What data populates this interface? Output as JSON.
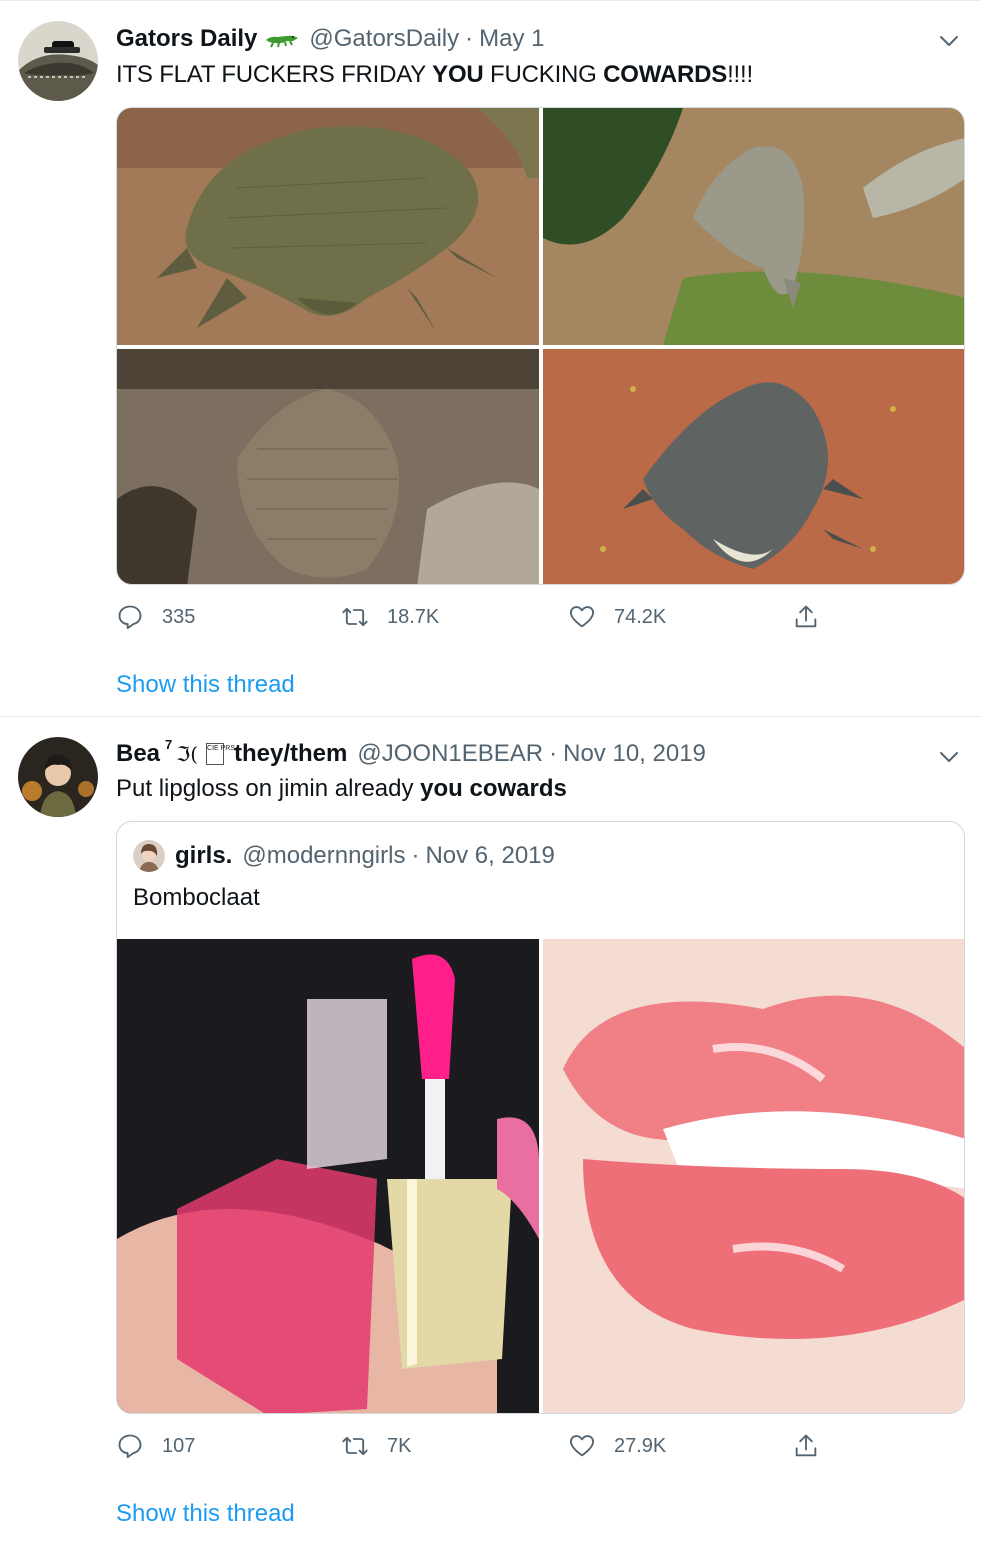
{
  "tweets": [
    {
      "display_name": "Gators Daily",
      "name_icon": "alligator-emoji-icon",
      "handle": "@GatorsDaily",
      "separator": "·",
      "date": "May 1",
      "text_parts": [
        "ITS FLAT FUCKERS FRIDAY ",
        "YOU",
        " FUCKING ",
        "COWARDS",
        "!!!!"
      ],
      "media": [
        {
          "icon": "crocodile-flat-sand-photo"
        },
        {
          "icon": "crocodiles-grass-photo"
        },
        {
          "icon": "crocodile-rock-photo"
        },
        {
          "icon": "crocodile-red-dirt-photo"
        }
      ],
      "actions": {
        "replies": "335",
        "retweets": "18.7K",
        "likes": "74.2K"
      },
      "show_thread": "Show this thread"
    },
    {
      "display_name": "Bea",
      "name_suffix": "7",
      "name_glyph": "ℑ(",
      "name_box": "CIE PRS",
      "pronouns": "they/them",
      "handle": "@JOON1EBEAR",
      "separator": "·",
      "date": "Nov 10, 2019",
      "text_parts": [
        "Put lipgloss on jimin already ",
        "you cowards"
      ],
      "quote": {
        "display_name": "girls.",
        "handle": "@modernngirls",
        "separator": "·",
        "date": "Nov 6, 2019",
        "text": "Bomboclaat",
        "media": [
          {
            "icon": "lip-oil-bottle-photo"
          },
          {
            "icon": "glossy-lips-photo"
          }
        ]
      },
      "actions": {
        "replies": "107",
        "retweets": "7K",
        "likes": "27.9K"
      },
      "show_thread": "Show this thread"
    }
  ],
  "colors": {
    "link": "#1d9bf0",
    "muted": "#536471",
    "border": "#e6ecf0",
    "text": "#0f1419"
  }
}
